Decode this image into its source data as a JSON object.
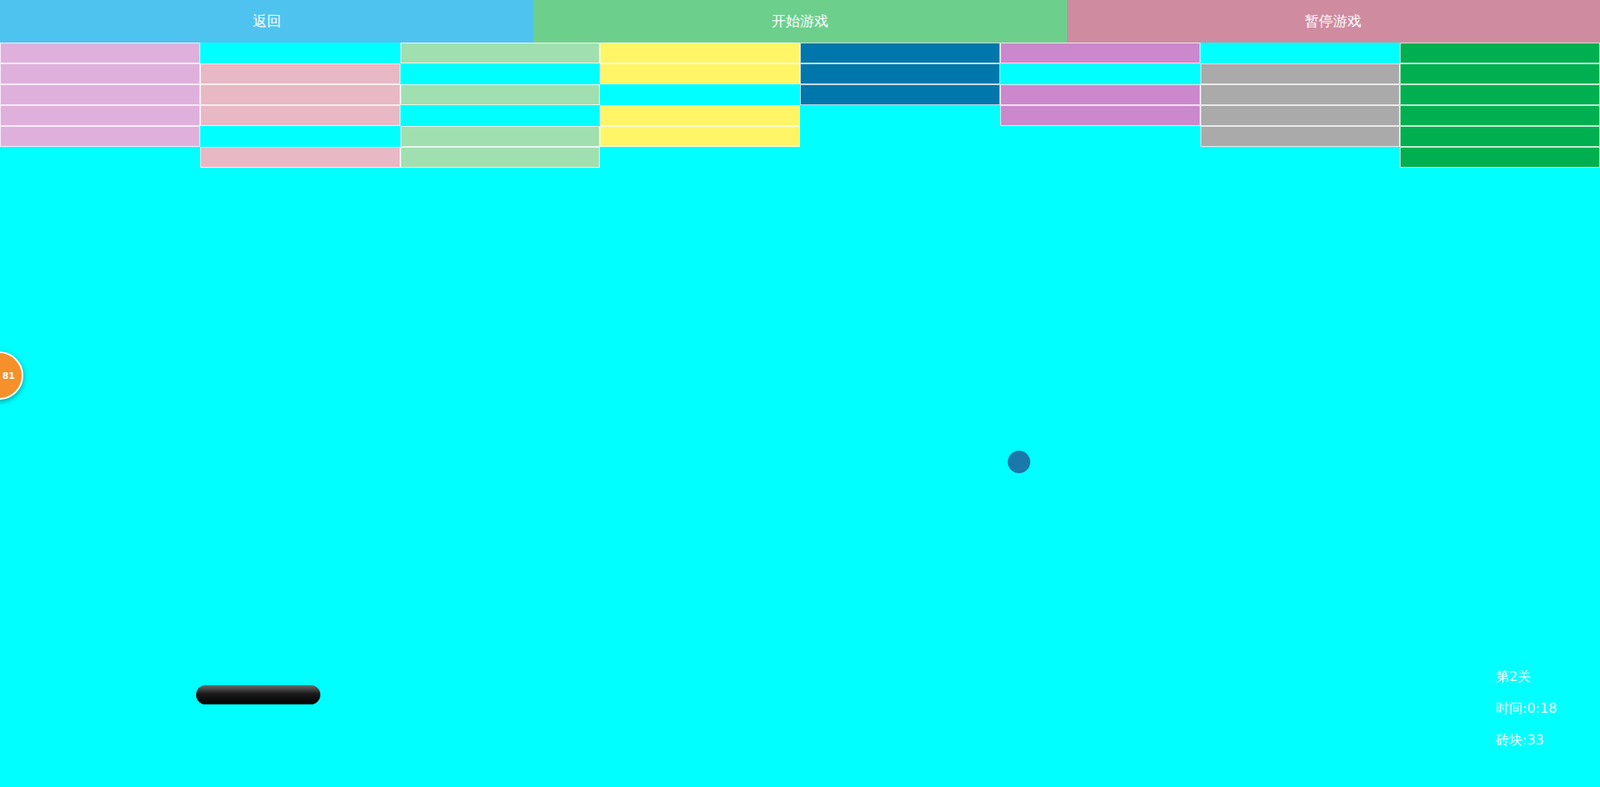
{
  "toolbar": [
    {
      "label": "返回",
      "color": "#4fc3f0"
    },
    {
      "label": "开始游戏",
      "color": "#6dcf8c"
    },
    {
      "label": "暂停游戏",
      "color": "#cf8ba0"
    }
  ],
  "bricks": [
    {
      "color": "#e0b0dd",
      "rows": [
        true,
        true,
        true,
        true,
        true,
        false
      ]
    },
    {
      "color": "#e8b8c4",
      "rows": [
        false,
        true,
        true,
        true,
        false,
        true
      ]
    },
    {
      "color": "#a0e0b0",
      "rows": [
        true,
        false,
        true,
        false,
        true,
        true
      ]
    },
    {
      "color": "#fff566",
      "rows": [
        true,
        true,
        false,
        true,
        true,
        false
      ]
    },
    {
      "color": "#0077aa",
      "rows": [
        true,
        true,
        true,
        false,
        false,
        false
      ]
    },
    {
      "color": "#cc88cc",
      "rows": [
        true,
        false,
        true,
        true,
        false,
        false
      ]
    },
    {
      "color": "#aaaaaa",
      "rows": [
        false,
        true,
        true,
        true,
        true,
        false
      ]
    },
    {
      "color": "#00b050",
      "rows": [
        true,
        true,
        true,
        true,
        true,
        true
      ]
    }
  ],
  "badge": {
    "text": "81"
  },
  "status": {
    "level": "第2关",
    "time": "时间:0:18",
    "bricks": "砖块:33"
  }
}
